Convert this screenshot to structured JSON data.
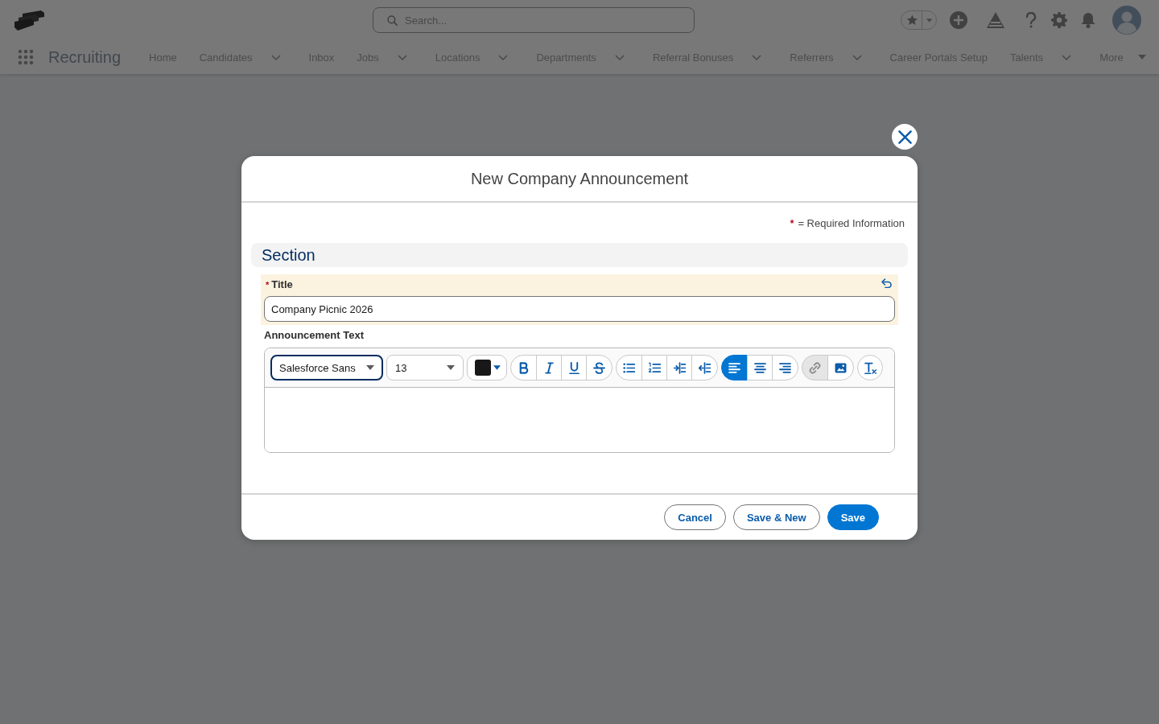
{
  "header": {
    "search": {
      "placeholder": "Search..."
    }
  },
  "nav": {
    "app_name": "Recruiting",
    "items": [
      {
        "label": "Home",
        "kind": "plain"
      },
      {
        "label": "Candidates",
        "kind": "menu"
      },
      {
        "label": "Inbox",
        "kind": "plain"
      },
      {
        "label": "Jobs",
        "kind": "menu"
      },
      {
        "label": "Locations",
        "kind": "menu"
      },
      {
        "label": "Departments",
        "kind": "menu"
      },
      {
        "label": "Referral Bonuses",
        "kind": "menu"
      },
      {
        "label": "Referrers",
        "kind": "menu"
      },
      {
        "label": "Career Portals Setup",
        "kind": "plain"
      },
      {
        "label": "Talents",
        "kind": "menu"
      },
      {
        "label": "More",
        "kind": "overflow"
      }
    ]
  },
  "modal": {
    "title": "New Company Announcement",
    "required_note": {
      "marker": "*",
      "text": "= Required Information"
    },
    "section": {
      "title": "Section",
      "fields": [
        {
          "kind": "text",
          "marker": "*",
          "label": "Title",
          "edited": true,
          "value": "Company Picnic 2026"
        },
        {
          "kind": "rich",
          "label": "Announcement Text",
          "edited": false,
          "toolbar": {
            "font": {
              "value": "Salesforce Sans",
              "focused": true
            },
            "size": {
              "value": "13",
              "focused": false
            },
            "groups": [
              {
                "buttons": [
                  {
                    "kind": "bold",
                    "selected": false,
                    "disabled": false
                  },
                  {
                    "kind": "italic",
                    "selected": false,
                    "disabled": false
                  },
                  {
                    "kind": "underline",
                    "selected": false,
                    "disabled": false
                  },
                  {
                    "kind": "strikethrough",
                    "selected": false,
                    "disabled": false
                  }
                ]
              },
              {
                "buttons": [
                  {
                    "kind": "bullets",
                    "selected": false,
                    "disabled": false
                  },
                  {
                    "kind": "numbering",
                    "selected": false,
                    "disabled": false
                  },
                  {
                    "kind": "indent",
                    "selected": false,
                    "disabled": false
                  },
                  {
                    "kind": "outdent",
                    "selected": false,
                    "disabled": false
                  }
                ]
              },
              {
                "buttons": [
                  {
                    "kind": "left",
                    "selected": true,
                    "disabled": false
                  },
                  {
                    "kind": "center",
                    "selected": false,
                    "disabled": false
                  },
                  {
                    "kind": "right",
                    "selected": false,
                    "disabled": false
                  }
                ]
              },
              {
                "buttons": [
                  {
                    "kind": "link",
                    "selected": false,
                    "disabled": true
                  },
                  {
                    "kind": "image",
                    "selected": false,
                    "disabled": false
                  }
                ]
              },
              {
                "buttons": [
                  {
                    "kind": "clear",
                    "selected": false,
                    "disabled": false
                  }
                ]
              }
            ]
          }
        }
      ]
    },
    "buttons": [
      {
        "label": "Cancel",
        "kind": "neutral"
      },
      {
        "label": "Save & New",
        "kind": "neutral"
      },
      {
        "label": "Save",
        "kind": "brand"
      }
    ]
  }
}
